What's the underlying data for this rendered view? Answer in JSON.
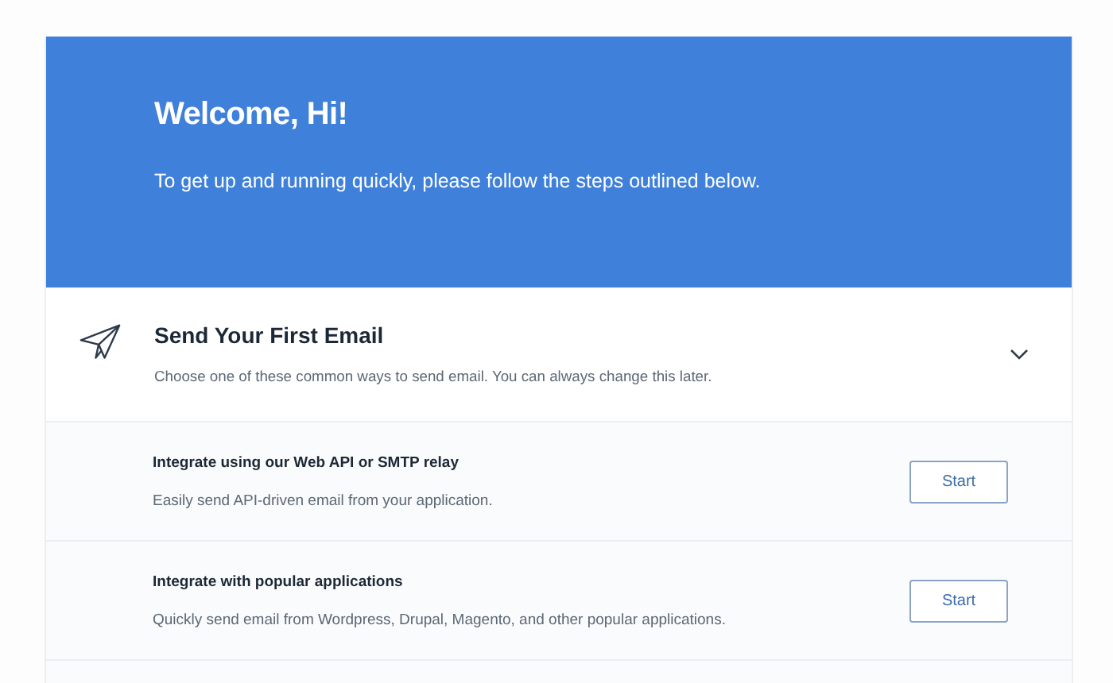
{
  "banner": {
    "title": "Welcome, Hi!",
    "subtitle": "To get up and running quickly, please follow the steps outlined below."
  },
  "section": {
    "title": "Send Your First Email",
    "description": "Choose one of these common ways to send email. You can always change this later.",
    "expanded": true,
    "options": [
      {
        "title": "Integrate using our Web API or SMTP relay",
        "description": "Easily send API-driven email from your application.",
        "button": "Start"
      },
      {
        "title": "Integrate with popular applications",
        "description": "Quickly send email from Wordpress, Drupal, Magento, and other popular applications.",
        "button": "Start"
      }
    ]
  }
}
